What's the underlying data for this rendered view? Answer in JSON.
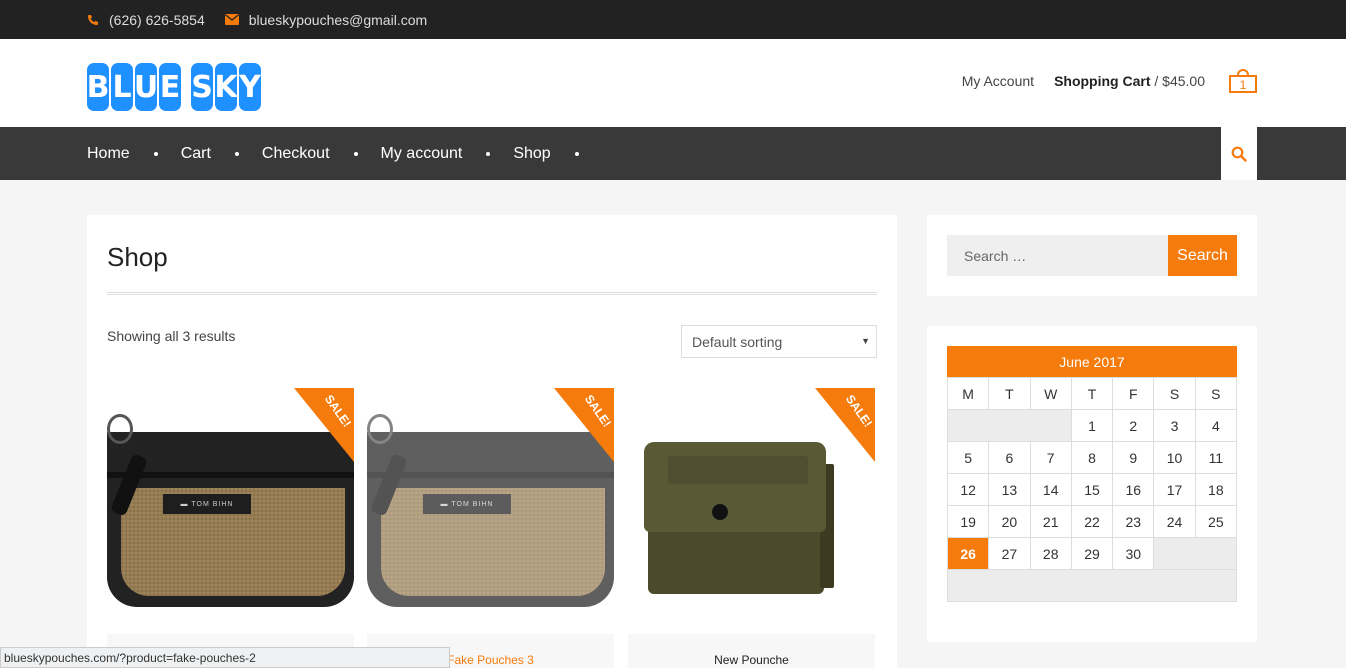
{
  "topbar": {
    "phone": "(626) 626-5854",
    "email": "blueskypouches@gmail.com",
    "accent": "#f47b0c"
  },
  "header": {
    "logo_letters": [
      "B",
      "L",
      "U",
      "E",
      "S",
      "K",
      "Y"
    ],
    "logo_text": "BLUE SKY",
    "my_account": "My Account",
    "cart_label": "Shopping Cart",
    "cart_sep": " / ",
    "cart_total": "$45.00",
    "cart_count": "1"
  },
  "nav": {
    "items": [
      {
        "label": "Home"
      },
      {
        "label": "Cart"
      },
      {
        "label": "Checkout"
      },
      {
        "label": "My account"
      },
      {
        "label": "Shop"
      }
    ]
  },
  "main": {
    "title": "Shop",
    "results": "Showing all 3 results",
    "sort_selected": "Default sorting",
    "products": [
      {
        "name": "",
        "sale": "SALE!"
      },
      {
        "name": "Fake Pouches 3",
        "sale": "SALE!"
      },
      {
        "name": "New Pounche",
        "sale": "SALE!"
      }
    ]
  },
  "sidebar": {
    "search_placeholder": "Search …",
    "search_button": "Search",
    "calendar": {
      "caption": "June 2017",
      "weekdays": [
        "M",
        "T",
        "W",
        "T",
        "F",
        "S",
        "S"
      ],
      "weeks": [
        [
          "",
          "",
          "",
          "1",
          "2",
          "3",
          "4"
        ],
        [
          "5",
          "6",
          "7",
          "8",
          "9",
          "10",
          "11"
        ],
        [
          "12",
          "13",
          "14",
          "15",
          "16",
          "17",
          "18"
        ],
        [
          "19",
          "20",
          "21",
          "22",
          "23",
          "24",
          "25"
        ],
        [
          "26",
          "27",
          "28",
          "29",
          "30",
          "",
          ""
        ],
        [
          "",
          "",
          "",
          "",
          "",
          "",
          ""
        ]
      ],
      "today": "26"
    }
  },
  "statusbar": {
    "url": "blueskypouches.com/?product=fake-pouches-2"
  }
}
